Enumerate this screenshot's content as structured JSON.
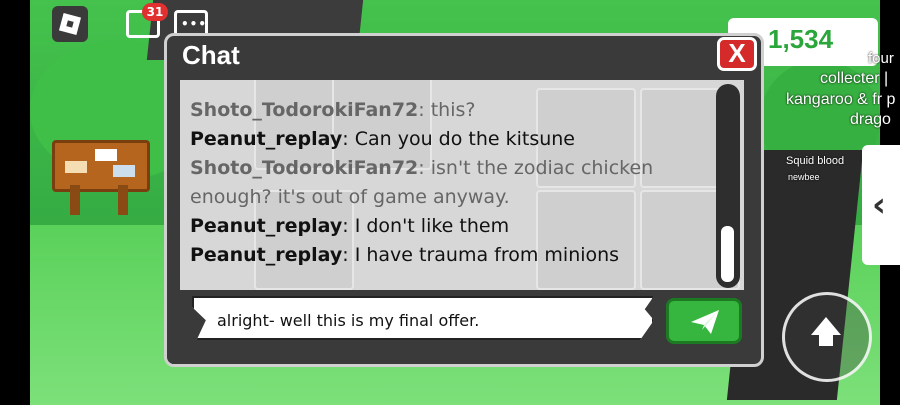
{
  "hud": {
    "chat_badge_count": "31",
    "money_value": "1,534"
  },
  "nametag_lines": [
    "four",
    "collecter |",
    "kangaroo & fr p",
    "drago",
    "Squid blood",
    "newbee"
  ],
  "chat": {
    "title": "Chat",
    "close_label": "X",
    "messages": [
      {
        "name": "Shoto_TodorokiFan72",
        "text": ": this?",
        "faded": true
      },
      {
        "name": "Peanut_replay",
        "text": ": Can you do the kitsune",
        "faded": false
      },
      {
        "name": "Shoto_TodorokiFan72",
        "text": ": isn't the zodiac chicken",
        "faded": true
      },
      {
        "name": "",
        "text": "enough? it's out of game anyway.",
        "faded": true
      },
      {
        "name": "Peanut_replay",
        "text": ":  I don't like them",
        "faded": false
      },
      {
        "name": "Peanut_replay",
        "text": ": I have trauma from minions",
        "faded": false
      }
    ],
    "input_value": "alright- well this is my final offer."
  },
  "colors": {
    "close_red": "#d42a2a",
    "send_green": "#36b63e",
    "money_green": "#2aa63a"
  }
}
